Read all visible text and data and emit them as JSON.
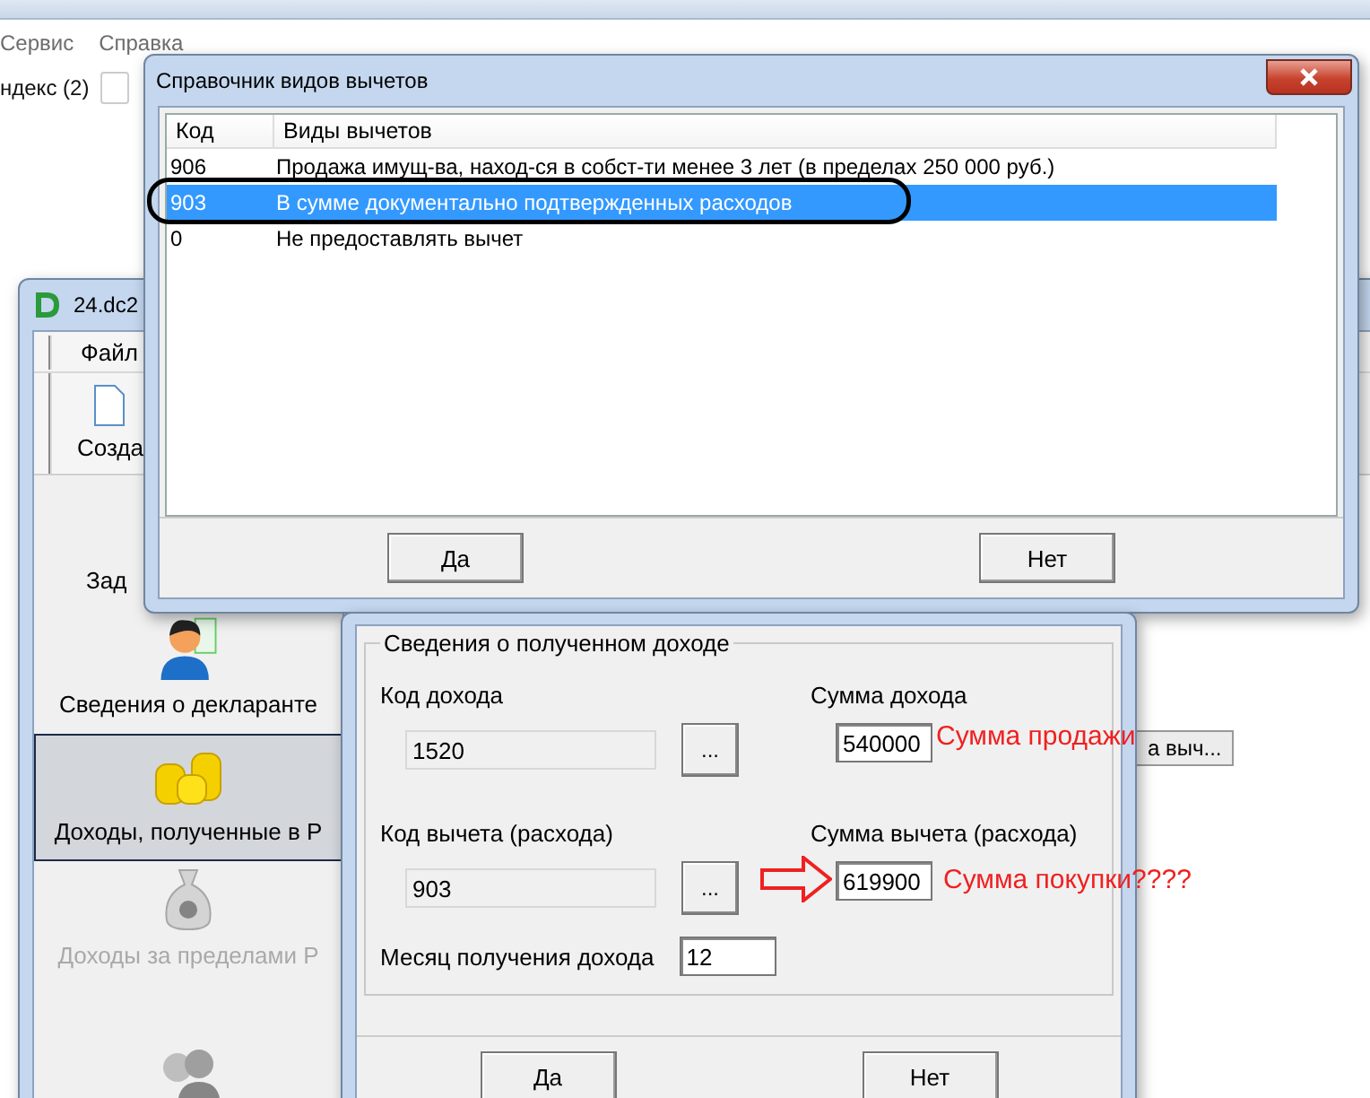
{
  "browser": {
    "menu": [
      "Сервис",
      "Справка"
    ],
    "bookmark": "ндекс (2)"
  },
  "main_window": {
    "title": "24.dc2",
    "menu": [
      "Файл"
    ],
    "toolbar": [
      "Созда"
    ],
    "sidebar": [
      {
        "label": "Зад",
        "kind": "tasks",
        "selected": false
      },
      {
        "label": "Сведения о декларанте",
        "kind": "person",
        "selected": false,
        "disabled": false
      },
      {
        "label": "Доходы, полученные в Р",
        "kind": "coins",
        "selected": true,
        "disabled": false
      },
      {
        "label": "Доходы за пределами Р",
        "kind": "moneybag",
        "selected": false,
        "disabled": true
      },
      {
        "kind": "people",
        "selected": false,
        "disabled": true
      }
    ],
    "tab": "а выч..."
  },
  "deductions_dialog": {
    "title": "Справочник видов вычетов",
    "columns": [
      "Код",
      "Виды вычетов"
    ],
    "rows": [
      {
        "code": "906",
        "name": "Продажа имущ-ва, наход-ся в собст-ти менее 3 лет (в пределах 250 000 руб.)",
        "selected": false
      },
      {
        "code": "903",
        "name": "В сумме документально подтвержденных расходов",
        "selected": true
      },
      {
        "code": "0",
        "name": "Не предоставлять вычет",
        "selected": false
      }
    ],
    "buttons": [
      "Да",
      "Нет"
    ]
  },
  "income_dialog": {
    "group": "Сведения о полученном доходе",
    "fields": [
      {
        "label": "Код дохода",
        "value": "1520",
        "kind": "lookup",
        "button": "..."
      },
      {
        "label": "Сумма дохода",
        "value": "540000",
        "kind": "input"
      },
      {
        "label": "Код вычета (расхода)",
        "value": "903",
        "kind": "lookup",
        "button": "..."
      },
      {
        "label": "Сумма вычета (расхода)",
        "value": "619900",
        "kind": "input"
      }
    ],
    "month": {
      "label": "Месяц получения дохода",
      "value": "12"
    },
    "buttons": [
      "Да",
      "Нет"
    ]
  },
  "annotations": [
    "Сумма продажи",
    "Сумма покупки????"
  ]
}
